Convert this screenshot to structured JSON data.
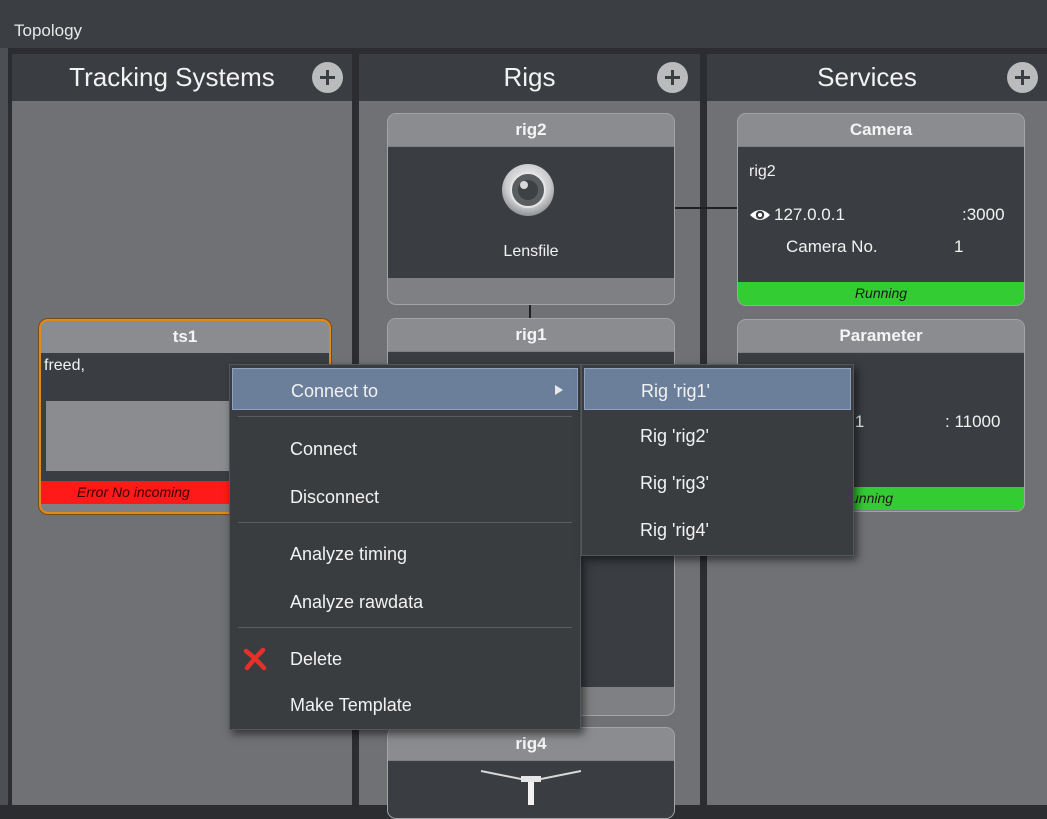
{
  "window": {
    "title": "Topology"
  },
  "columns": {
    "tracking": {
      "header": "Tracking Systems"
    },
    "rigs": {
      "header": "Rigs"
    },
    "services": {
      "header": "Services"
    }
  },
  "tracking_systems": [
    {
      "name": "ts1",
      "text": "freed,",
      "status": "Error No incoming",
      "status_color": "#ff1a1a"
    }
  ],
  "rigs": [
    {
      "name": "rig2",
      "label": "Lensfile"
    },
    {
      "name": "rig1"
    },
    {
      "name": "rig4"
    }
  ],
  "services": [
    {
      "name": "Camera",
      "rig": "rig2",
      "ip": "127.0.0.1",
      "port": ":3000",
      "camera_label": "Camera No.",
      "camera_no": "1",
      "status": "Running",
      "status_color": "#33cc33"
    },
    {
      "name": "Parameter",
      "ip_partial": ".1",
      "port": ": 11000",
      "status": "unning",
      "status_color": "#33cc33"
    }
  ],
  "context_menu": {
    "items": [
      {
        "label": "Connect to"
      },
      {
        "label": "Connect"
      },
      {
        "label": "Disconnect"
      },
      {
        "label": "Analyze timing"
      },
      {
        "label": "Analyze rawdata"
      },
      {
        "label": "Delete"
      },
      {
        "label": "Make Template"
      }
    ],
    "submenu": [
      {
        "label": "Rig 'rig1'"
      },
      {
        "label": "Rig 'rig2'"
      },
      {
        "label": "Rig 'rig3'"
      },
      {
        "label": "Rig 'rig4'"
      }
    ]
  },
  "icons": {
    "submenu_arrow": "triangle-right-icon",
    "delete": "red-x-icon",
    "eye": "eye-icon",
    "lens": "lens-icon"
  },
  "colors": {
    "highlight": "#6b7f9a",
    "running": "#33cc33",
    "error": "#ff1a1a",
    "selected_border": "#e08a1a"
  }
}
